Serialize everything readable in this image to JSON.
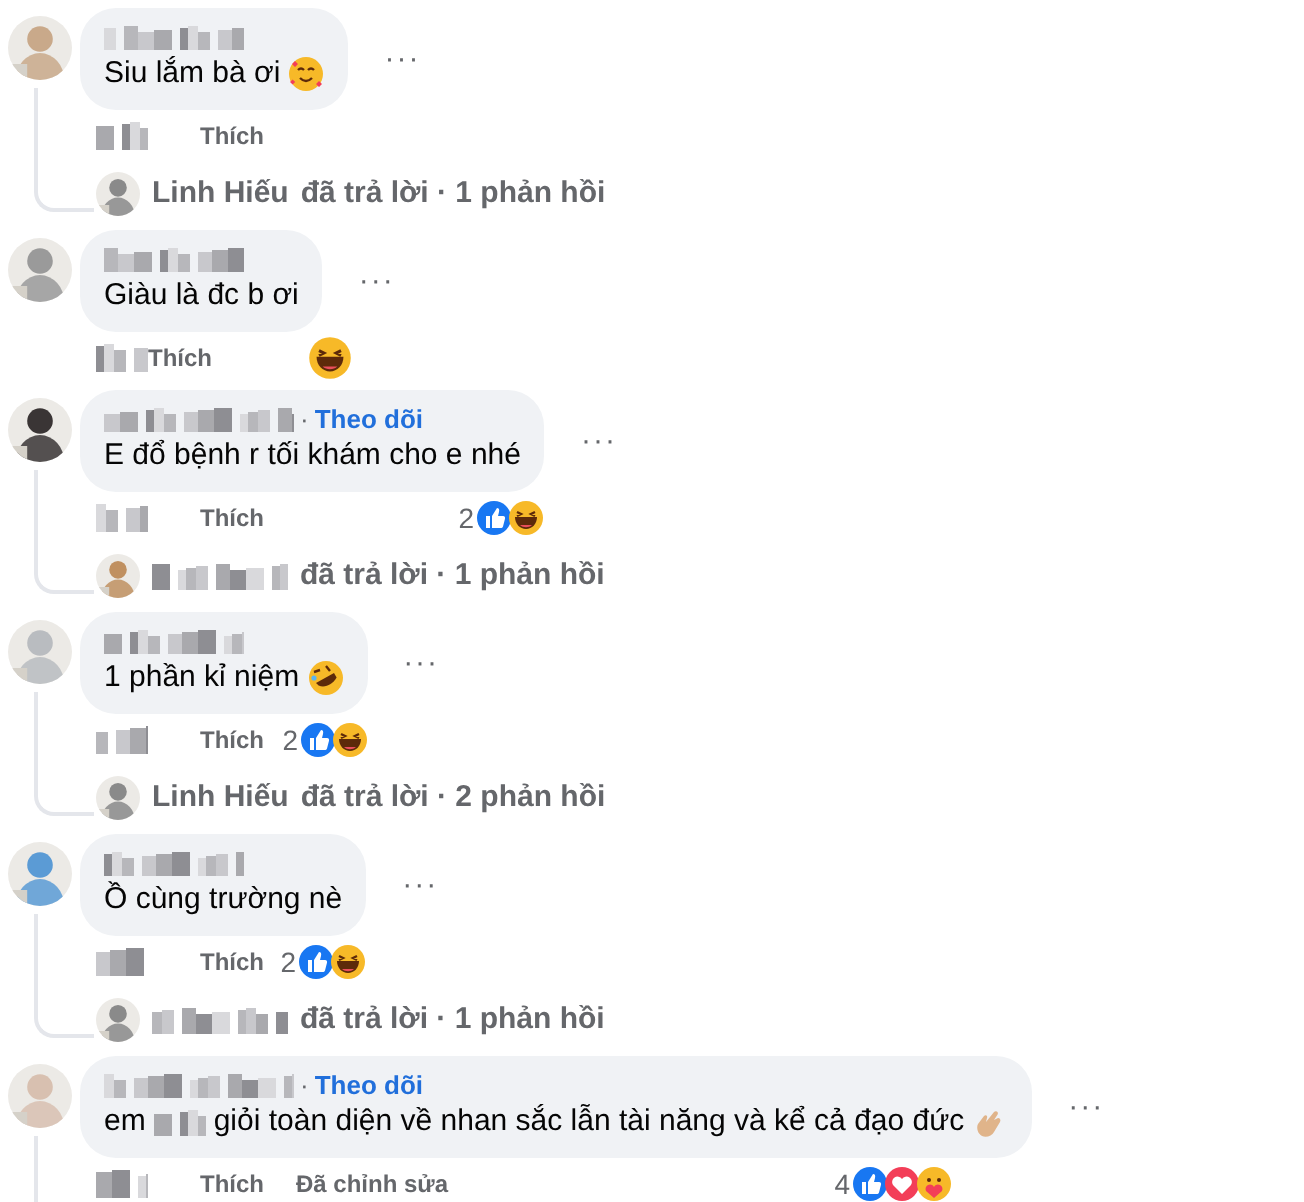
{
  "comments": [
    {
      "text": "Siu lắm bà ơi",
      "text_emoji": {
        "kind": "smile-hearts"
      },
      "more": "···",
      "like": "Thích",
      "reply": {
        "name": "Linh Hiếu",
        "text": "đã trả lời · 1 phản hồi"
      }
    },
    {
      "text": "Giàu là đc b ơi",
      "more": "···",
      "like": "Thích",
      "reactions": [
        {
          "kind": "haha"
        }
      ]
    },
    {
      "separator": "·",
      "follow": "Theo dõi",
      "text": "E đổ bệnh r tối khám cho e nhé",
      "more": "···",
      "like": "Thích",
      "reaction_count": "2",
      "reactions": [
        {
          "kind": "like"
        },
        {
          "kind": "haha"
        }
      ],
      "reply": {
        "text": "đã trả lời · 1 phản hồi"
      }
    },
    {
      "text": "1 phần kỉ niệm",
      "text_emoji": {
        "kind": "rofl"
      },
      "more": "···",
      "like": "Thích",
      "reaction_count": "2",
      "reactions": [
        {
          "kind": "like"
        },
        {
          "kind": "haha"
        }
      ],
      "reply": {
        "name": "Linh Hiếu",
        "text": "đã trả lời · 2 phản hồi"
      }
    },
    {
      "text": "Ồ cùng trường nè",
      "more": "···",
      "like": "Thích",
      "reaction_count": "2",
      "reactions": [
        {
          "kind": "like"
        },
        {
          "kind": "haha"
        }
      ],
      "reply": {
        "text": "đã trả lời · 1 phản hồi"
      }
    },
    {
      "separator": "·",
      "follow": "Theo dõi",
      "text_prefix": "em",
      "text": "giỏi toàn diện về nhan sắc lẫn tài năng và kể cả đạo đức",
      "text_emoji": {
        "kind": "finger-heart"
      },
      "more": "···",
      "like": "Thích",
      "edited": "Đã chỉnh sửa",
      "reaction_count": "4",
      "reactions": [
        {
          "kind": "like"
        },
        {
          "kind": "love"
        },
        {
          "kind": "care"
        }
      ],
      "continues": true
    }
  ]
}
